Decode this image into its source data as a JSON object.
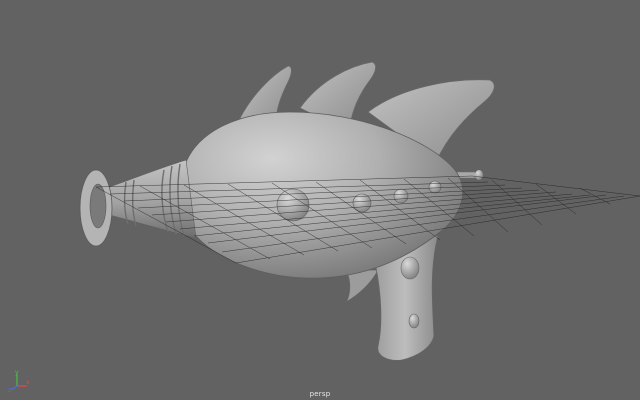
{
  "viewport": {
    "camera_name": "persp",
    "background_color": "#626262",
    "model_color": "#a9a9a9",
    "grid_color": "#1e1e1e"
  },
  "axis_gizmo": {
    "x_label": "x",
    "y_label": "y",
    "z_label": "z",
    "x_color": "#e04848",
    "y_color": "#48c048",
    "z_color": "#4a6ee0"
  }
}
